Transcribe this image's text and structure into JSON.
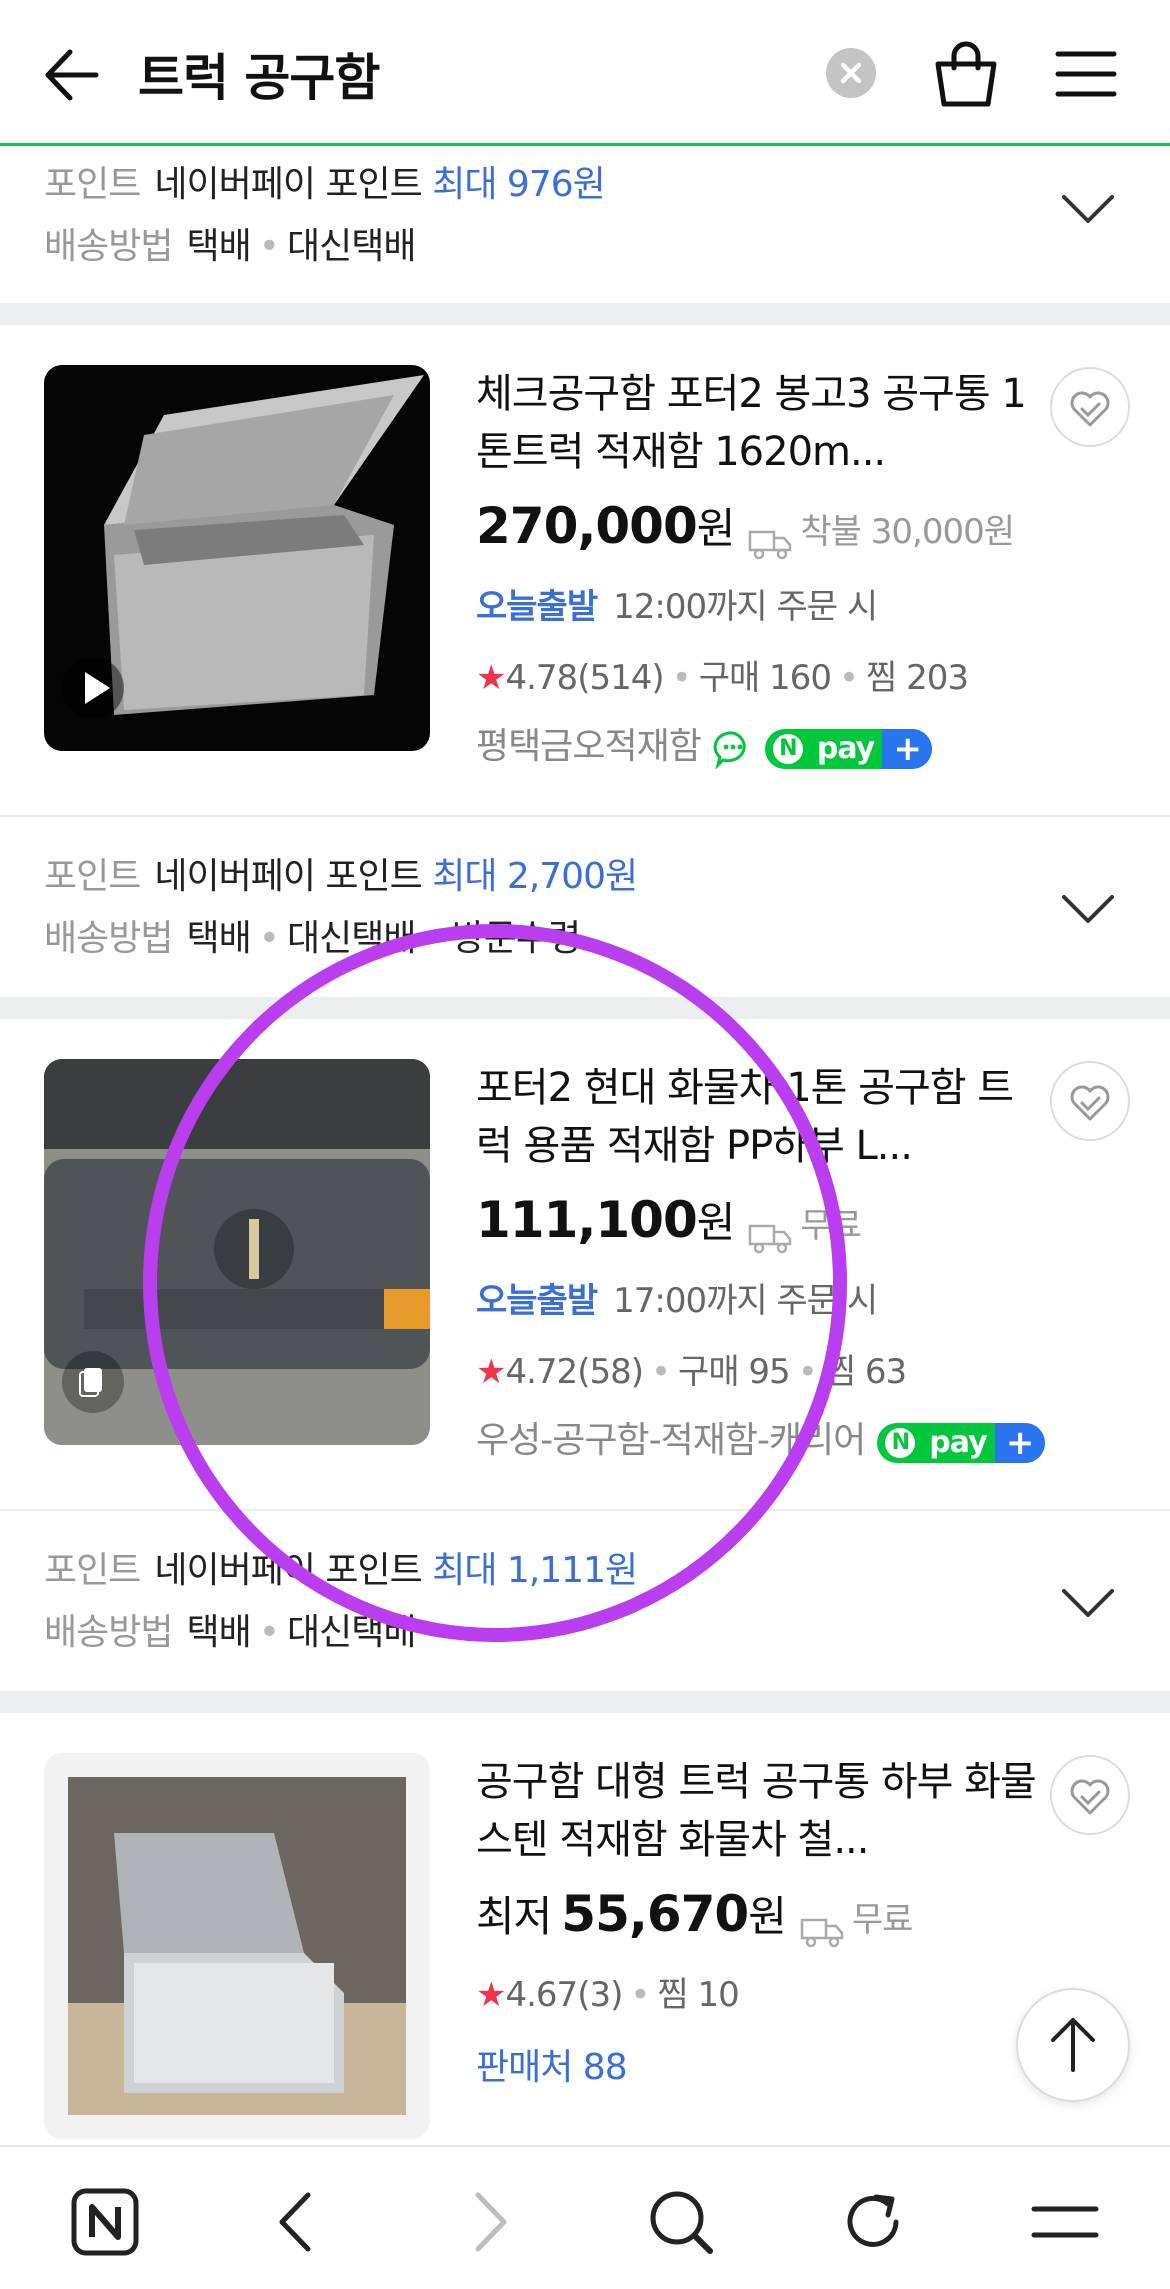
{
  "header": {
    "search_query": "트럭 공구함"
  },
  "top_info": {
    "point_label": "포인트",
    "point_text": "네이버페이 포인트",
    "point_value": "최대 976원",
    "delivery_label": "배송방법",
    "delivery_1": "택배",
    "delivery_2": "대신택배"
  },
  "products": [
    {
      "title": "체크공구함 포터2 봉고3 공구통 1톤트럭 적재함 1620m...",
      "price": "270,000",
      "won": "원",
      "shipping": "착불 30,000원",
      "today_label": "오늘출발",
      "today_text": "12:00까지 주문 시",
      "rating": "4.78",
      "reviews": "(514)",
      "purchases": "구매 160",
      "likes": "찜 203",
      "seller": "평택금오적재함",
      "thumb_badge": "play-icon",
      "info": {
        "point_label": "포인트",
        "point_text": "네이버페이 포인트",
        "point_value": "최대 2,700원",
        "delivery_label": "배송방법",
        "delivery_1": "택배",
        "delivery_2": "대신택배",
        "delivery_3": "방문수령"
      }
    },
    {
      "title": "포터2 현대 화물차 1톤 공구함 트럭 용품 적재함 PP하부 L...",
      "price": "111,100",
      "won": "원",
      "shipping": "무료",
      "today_label": "오늘출발",
      "today_text": "17:00까지 주문 시",
      "rating": "4.72",
      "reviews": "(58)",
      "purchases": "구매 95",
      "likes": "찜 63",
      "seller": "우성-공구함-적재함-캐리어",
      "thumb_badge": "image-gallery-icon",
      "info": {
        "point_label": "포인트",
        "point_text": "네이버페이 포인트",
        "point_value": "최대 1,111원",
        "delivery_label": "배송방법",
        "delivery_1": "택배",
        "delivery_2": "대신택배"
      }
    },
    {
      "title": "공구함 대형 트럭 공구통 하부 화물 스텐 적재함 화물차 철...",
      "price_prefix": "최저",
      "price": "55,670",
      "won": "원",
      "shipping": "무료",
      "rating": "4.67",
      "reviews": "(3)",
      "likes": "찜 10",
      "sellers": "판매처 88"
    }
  ],
  "npay": {
    "label": "pay",
    "n": "N",
    "plus": "+"
  },
  "colors": {
    "header_line": "#19c24a",
    "link_blue": "#3a6fd8",
    "star_red": "#f0354a",
    "annotation_circle": "#b93ef0",
    "npay_green": "#00c73c",
    "npay_blue": "#2a74f0"
  }
}
